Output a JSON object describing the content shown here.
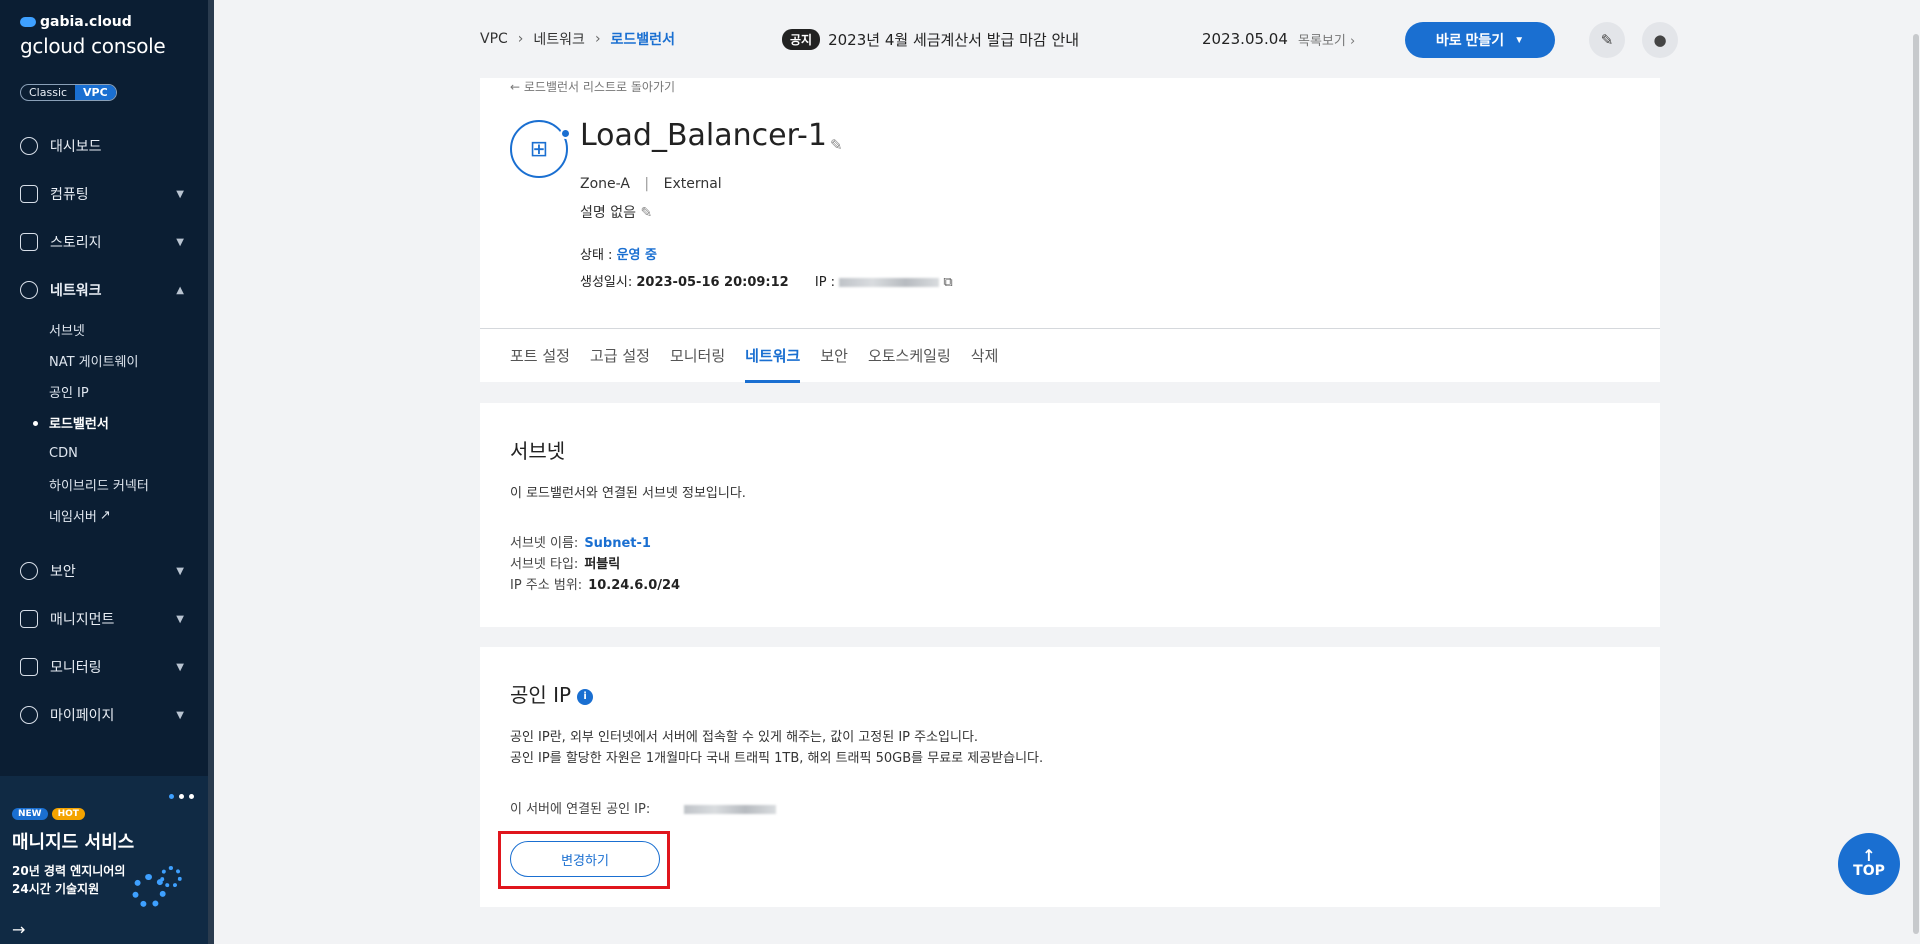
{
  "sidebar": {
    "brand_top": "gabia.cloud",
    "brand_console": "gcloud console",
    "toggle": [
      "Classic",
      "VPC"
    ],
    "items": [
      {
        "label": "대시보드"
      },
      {
        "label": "컴퓨팅"
      },
      {
        "label": "스토리지"
      },
      {
        "label": "네트워크"
      },
      {
        "label": "보안"
      },
      {
        "label": "매니지먼트"
      },
      {
        "label": "모니터링"
      },
      {
        "label": "마이페이지"
      }
    ],
    "network_sub": [
      "서브넷",
      "NAT 게이트웨이",
      "공인 IP",
      "로드밸런서",
      "CDN",
      "하이브리드 커넥터",
      "네임서버"
    ],
    "promo": {
      "badge_new": "NEW",
      "badge_hot": "HOT",
      "title": "매니지드 서비스",
      "line1": "20년 경력 엔지니어의",
      "line2": "24시간 기술지원"
    }
  },
  "header": {
    "breadcrumb": [
      "VPC",
      "네트워크",
      "로드밸런서"
    ],
    "notice_tag": "공지",
    "notice_text": "2023년 4월 세금계산서 발급 마감 안내",
    "date": "2023.05.04",
    "more": "목록보기",
    "make_button": "바로 만들기"
  },
  "lb": {
    "back": "← 로드밸런서 리스트로 돌아가기",
    "name": "Load_Balancer-1",
    "zone": "Zone-A",
    "type": "External",
    "description": "설명 없음",
    "status_label": "상태 :",
    "status_value": "운영 중",
    "created_label": "생성일시:",
    "created_value": "2023-05-16 20:09:12",
    "ip_label": "IP :"
  },
  "tabs": [
    "포트 설정",
    "고급 설정",
    "모니터링",
    "네트워크",
    "보안",
    "오토스케일링",
    "삭제"
  ],
  "subnet": {
    "title": "서브넷",
    "desc": "이 로드밸런서와 연결된 서브넷 정보입니다.",
    "name_label": "서브넷 이름:",
    "name_value": "Subnet-1",
    "type_label": "서브넷 타입:",
    "type_value": "퍼블릭",
    "range_label": "IP 주소 범위:",
    "range_value": "10.24.6.0/24"
  },
  "public_ip": {
    "title": "공인 IP",
    "desc1": "공인 IP란, 외부 인터넷에서 서버에 접속할 수 있게 해주는, 값이 고정된 IP 주소입니다.",
    "desc2": "공인 IP를 할당한 자원은 1개월마다 국내 트래픽 1TB, 해외 트래픽 50GB를 무료로 제공받습니다.",
    "connected_label": "이 서버에 연결된 공인 IP:",
    "change_button": "변경하기"
  },
  "top_button": "TOP"
}
